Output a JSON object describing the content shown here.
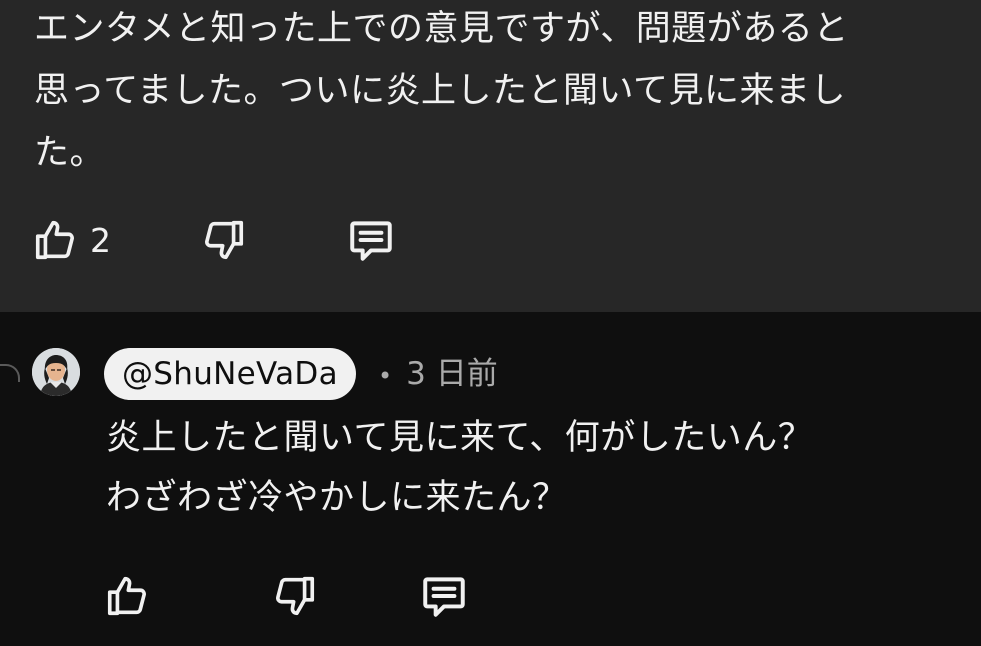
{
  "parent_comment": {
    "text": "エンタメと知った上での意見ですが、問題があると\n思ってました。ついに炎上したと聞いて見に来まし\nた。",
    "like_count": "2"
  },
  "reply": {
    "author_handle": "@ShuNeVaDa",
    "separator": "•",
    "time_ago": "3 日前",
    "text": "炎上したと聞いて見に来て、何がしたいん？\nわざわざ冷やかしに来たん？"
  },
  "icons": {
    "like": "thumbs-up-icon",
    "dislike": "thumbs-down-icon",
    "reply": "comment-icon"
  },
  "colors": {
    "highlight_bg": "#272727",
    "page_bg": "#0f0f0f",
    "text": "#f1f1f1",
    "meta_text": "#aaaaaa"
  }
}
